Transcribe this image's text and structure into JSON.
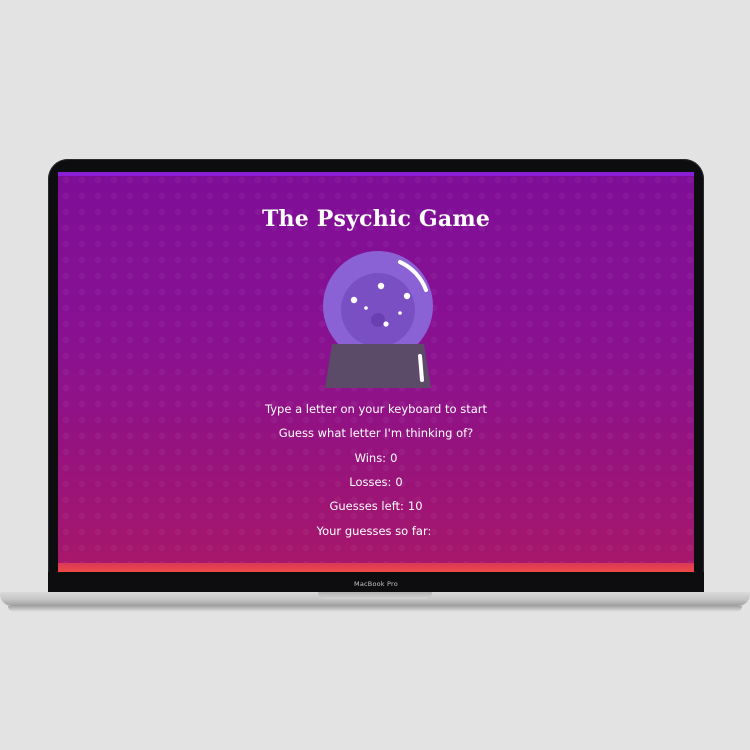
{
  "device": {
    "brand_label": "MacBook Pro"
  },
  "game": {
    "title": "The Psychic Game",
    "instruction": "Type a letter on your keyboard to start",
    "prompt": "Guess what letter I'm thinking of?",
    "wins_label": "Wins:",
    "wins_value": "0",
    "losses_label": "Losses:",
    "losses_value": "0",
    "guesses_left_label": "Guesses left:",
    "guesses_left_value": "10",
    "guesses_so_far_label": "Your guesses so far:",
    "guesses_so_far_value": ""
  },
  "illustration": {
    "icon": "crystal-ball-icon",
    "colors": {
      "globe": "#8b62d6",
      "globe_inner": "#7a4fc4",
      "stand": "#5b4a68",
      "stand_highlight": "#ffffff"
    }
  },
  "theme": {
    "background_top": "#7e0e98",
    "background_bottom": "#a8186a",
    "accent_strip": "#ee4a46"
  }
}
